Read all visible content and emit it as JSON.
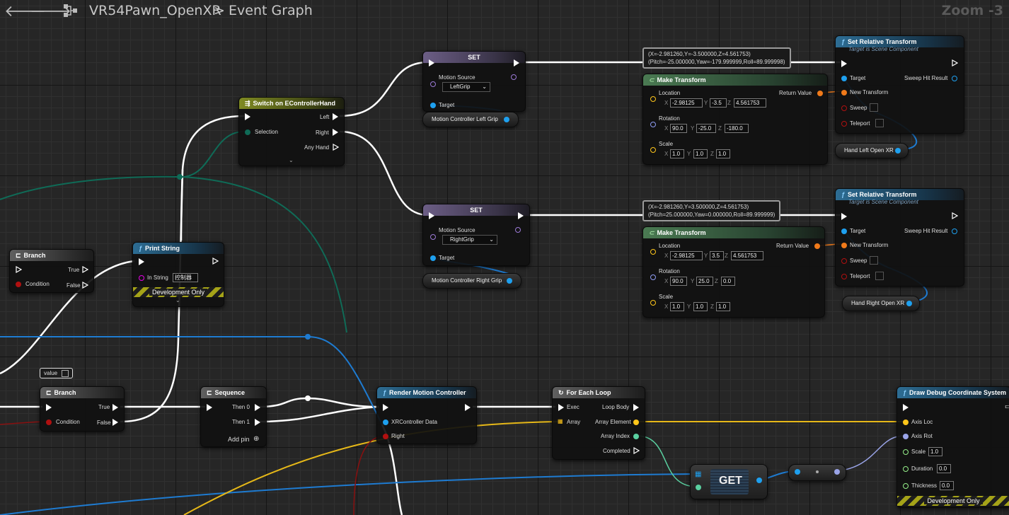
{
  "toolbar": {
    "back_glyph": "🡐",
    "forward_glyph": "🡒",
    "blueprint_name": "VR54Pawn_OpenXR",
    "separator": ">",
    "graph_name": "Event Graph",
    "zoom": "Zoom -3"
  },
  "nodes": {
    "set_left": {
      "title": "SET",
      "source_label": "Motion Source",
      "source_value": "LeftGrip",
      "target_label": "Target",
      "var": "Motion Controller Left Grip"
    },
    "set_right": {
      "title": "SET",
      "source_label": "Motion Source",
      "source_value": "RightGrip",
      "target_label": "Target",
      "var": "Motion Controller Right Grip"
    },
    "switch": {
      "title": "Switch on EControllerHand",
      "selection": "Selection",
      "left": "Left",
      "right": "Right",
      "any": "Any Hand"
    },
    "tooltip_left": {
      "line1": "(X=-2.981260,Y=-3.500000,Z=4.561753)",
      "line2": "(Pitch=-25.000000,Yaw=-179.999999,Roll=89.999998)"
    },
    "tooltip_right": {
      "line1": "(X=-2.981260,Y=3.500000,Z=4.561753)",
      "line2": "(Pitch=25.000000,Yaw=0.000000,Roll=89.999999)"
    },
    "make_left": {
      "title": "Make Transform",
      "location": "Location",
      "rotation": "Rotation",
      "scale": "Scale",
      "return": "Return Value",
      "loc": [
        "-2.98125",
        "-3.5",
        "4.561753"
      ],
      "rot": [
        "90.0",
        "-25.0",
        "-180.0"
      ],
      "scl": [
        "1.0",
        "1.0",
        "1.0"
      ]
    },
    "make_right": {
      "title": "Make Transform",
      "location": "Location",
      "rotation": "Rotation",
      "scale": "Scale",
      "return": "Return Value",
      "loc": [
        "-2.98125",
        "3.5",
        "4.561753"
      ],
      "rot": [
        "90.0",
        "25.0",
        "0.0"
      ],
      "scl": [
        "1.0",
        "1.0",
        "1.0"
      ]
    },
    "axis_labels": {
      "x": "X",
      "y": "Y",
      "z": "Z"
    },
    "srt_left": {
      "title": "Set Relative Transform",
      "subtitle": "Target is Scene Component",
      "target": "Target",
      "new_transform": "New Transform",
      "sweep": "Sweep",
      "teleport": "Teleport",
      "sweep_hit": "Sweep Hit Result",
      "var": "Hand Left Open XR"
    },
    "srt_right": {
      "title": "Set Relative Transform",
      "subtitle": "Target is Scene Component",
      "target": "Target",
      "new_transform": "New Transform",
      "sweep": "Sweep",
      "teleport": "Teleport",
      "sweep_hit": "Sweep Hit Result",
      "var": "Hand Right Open XR"
    },
    "branch_top": {
      "title": "Branch",
      "condition": "Condition",
      "true": "True",
      "false": "False"
    },
    "print_string": {
      "title": "Print String",
      "in_string": "In String",
      "in_value": "控制器",
      "dev": "Development Only"
    },
    "value_comment": "value",
    "branch_bottom": {
      "title": "Branch",
      "condition": "Condition",
      "true": "True",
      "false": "False"
    },
    "sequence": {
      "title": "Sequence",
      "then0": "Then 0",
      "then1": "Then 1",
      "add_pin": "Add pin"
    },
    "render": {
      "title": "Render Motion Controller",
      "xr_data": "XRController Data",
      "right": "Right"
    },
    "foreach": {
      "title": "For Each Loop",
      "exec": "Exec",
      "array": "Array",
      "loop_body": "Loop Body",
      "array_element": "Array Element",
      "array_index": "Array Index",
      "completed": "Completed"
    },
    "get": {
      "title": "GET"
    },
    "debug": {
      "title": "Draw Debug Coordinate System",
      "axis_loc": "Axis Loc",
      "axis_rot": "Axis Rot",
      "scale": "Scale",
      "scale_v": "1.0",
      "duration": "Duration",
      "duration_v": "0.0",
      "thickness": "Thickness",
      "thickness_v": "0.0",
      "dev": "Development Only"
    }
  },
  "colors": {
    "exec": "#ffffff",
    "object": "#1ea0ef",
    "struct": "#f07a1a",
    "bool": "#b01010",
    "vector": "#ffc61a",
    "rotator": "#8f9cf3",
    "string": "#e600e6",
    "enum": "#0d6e56",
    "float": "#96f08a"
  }
}
